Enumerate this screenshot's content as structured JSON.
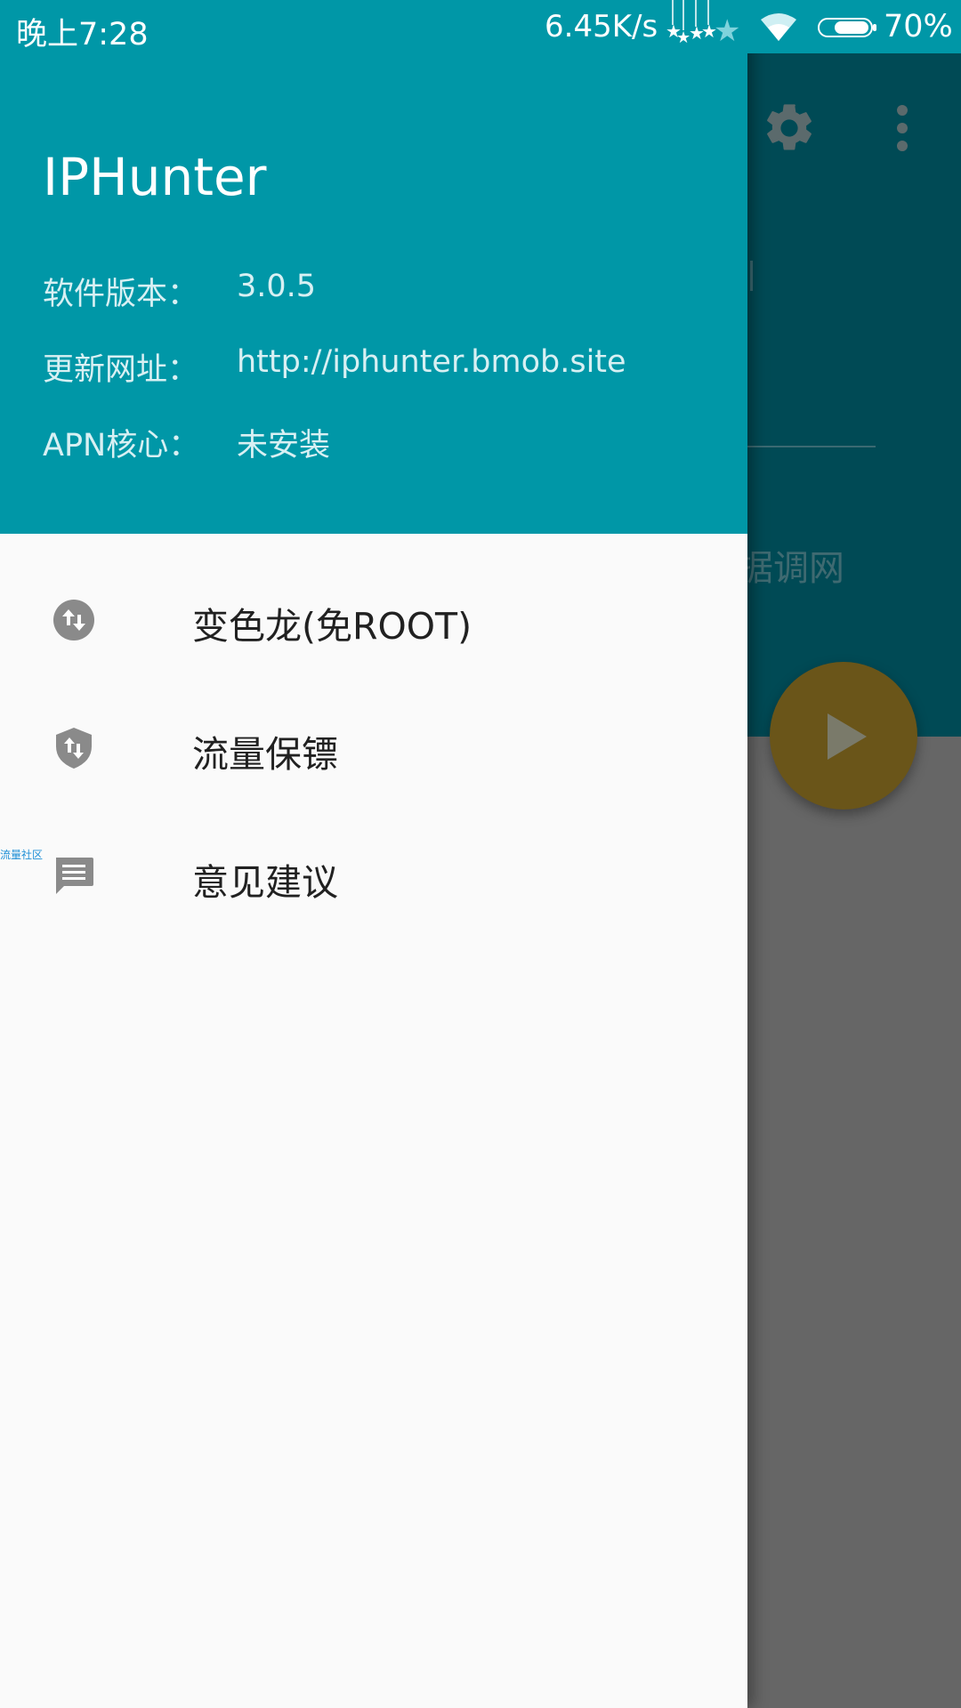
{
  "status_bar": {
    "time": "晚上7:28",
    "net_speed": "6.45K/s",
    "battery_percent": "70%",
    "icons": [
      "notification-stars-icon",
      "wifi-icon",
      "battery-icon"
    ]
  },
  "background": {
    "partial_text": "据调网",
    "icons": [
      "gear-icon",
      "more-vert-icon",
      "play-icon"
    ]
  },
  "drawer": {
    "app_name": "IPHunter",
    "info": [
      {
        "label": "软件版本：",
        "value": "3.0.5"
      },
      {
        "label": "更新网址：",
        "value": "http://iphunter.bmob.site"
      },
      {
        "label": "APN核心：",
        "value": "未安装"
      }
    ],
    "menu": [
      {
        "label": "变色龙(免ROOT)",
        "icon": "swap-vert-circle-icon"
      },
      {
        "label": "流量保镖",
        "icon": "shield-swap-icon"
      },
      {
        "label": "意见建议",
        "icon": "message-icon"
      }
    ]
  },
  "side_tag": "流量社区",
  "colors": {
    "primary": "#0097a7",
    "primary_dark_dimmed": "#004a55",
    "fab_dimmed": "#6a5519",
    "drawer_bg": "#fafafa",
    "menu_icon": "#8a8a8a"
  }
}
